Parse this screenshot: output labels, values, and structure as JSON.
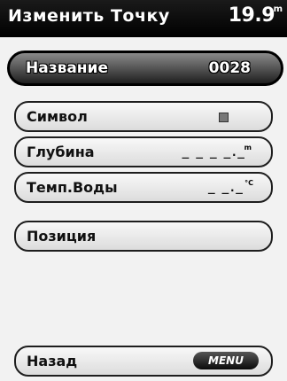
{
  "header": {
    "title": "Изменить Точку",
    "value": "19.9",
    "unit": "m"
  },
  "items": [
    {
      "label": "Название",
      "value": "0028"
    },
    {
      "label": "Символ",
      "icon": "square-symbol-icon"
    },
    {
      "label": "Глубина",
      "value": "_ _ _ _._",
      "unit": "m"
    },
    {
      "label": "Темп.Воды",
      "value": "_ _._",
      "unit": "°C"
    },
    {
      "label": "Позиция"
    }
  ],
  "footer": {
    "back_label": "Назад",
    "menu_label": "MENU"
  }
}
